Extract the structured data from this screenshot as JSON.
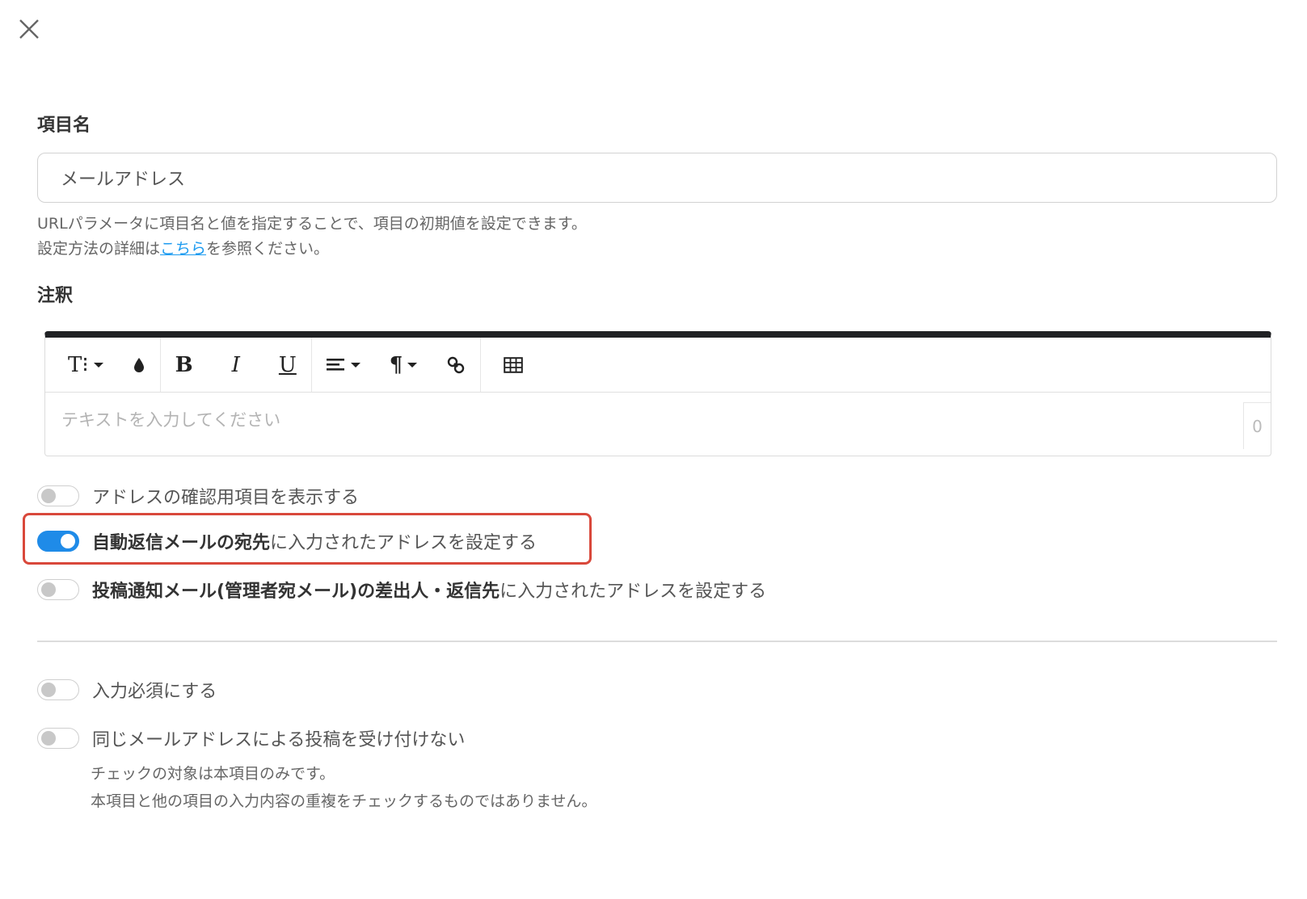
{
  "close": {
    "icon": "close-icon"
  },
  "item_name": {
    "label": "項目名",
    "value": "メールアドレス",
    "help_line1": "URLパラメータに項目名と値を指定することで、項目の初期値を設定できます。",
    "help_line2_pre": "設定方法の詳細は",
    "help_line2_link": "こちら",
    "help_line2_post": "を参照ください。"
  },
  "annotation": {
    "label": "注釈",
    "toolbar": {
      "text_size": "T⁝",
      "color_icon": "droplet-icon",
      "bold": "B",
      "italic": "I",
      "underline": "U",
      "align_icon": "align-left-icon",
      "paragraph": "¶",
      "link_icon": "link-icon",
      "table_icon": "table-icon"
    },
    "placeholder": "テキストを入力してください",
    "char_count": "0"
  },
  "toggles": [
    {
      "bold": "",
      "text": "アドレスの確認用項目を表示する",
      "on": false
    },
    {
      "bold": "自動返信メールの宛先",
      "text": "に入力されたアドレスを設定する",
      "on": true
    },
    {
      "bold": "投稿通知メール(管理者宛メール)の差出人・返信先",
      "text": "に入力されたアドレスを設定する",
      "on": false
    },
    {
      "bold": "",
      "text": "入力必須にする",
      "on": false
    },
    {
      "bold": "",
      "text": "同じメールアドレスによる投稿を受け付けない",
      "on": false
    }
  ],
  "duplicate_note": {
    "line1": "チェックの対象は本項目のみです。",
    "line2": "本項目と他の項目の入力内容の重複をチェックするものではありません。"
  },
  "colors": {
    "accent": "#1f8be8",
    "highlight": "#d9483b",
    "link": "#1d9bf0"
  }
}
